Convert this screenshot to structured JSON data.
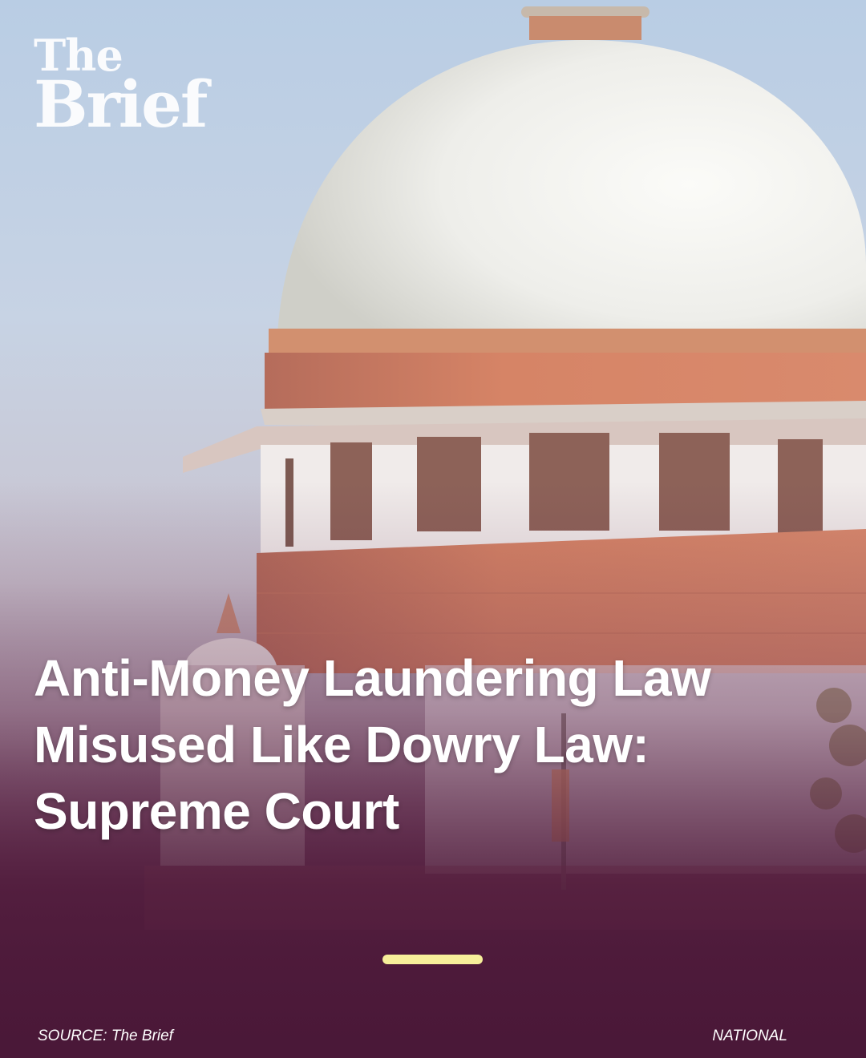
{
  "brand": {
    "logo_line1": "The",
    "logo_line2": "Brief"
  },
  "headline": {
    "line1": "Anti-Money Laundering Law",
    "line2": "Misused Like Dowry Law:",
    "line3": "Supreme Court"
  },
  "footer": {
    "source": "SOURCE: The Brief",
    "category": "NATIONAL"
  },
  "colors": {
    "accent": "#f7ef9a",
    "background": "#4a1a38",
    "text": "#ffffff"
  }
}
